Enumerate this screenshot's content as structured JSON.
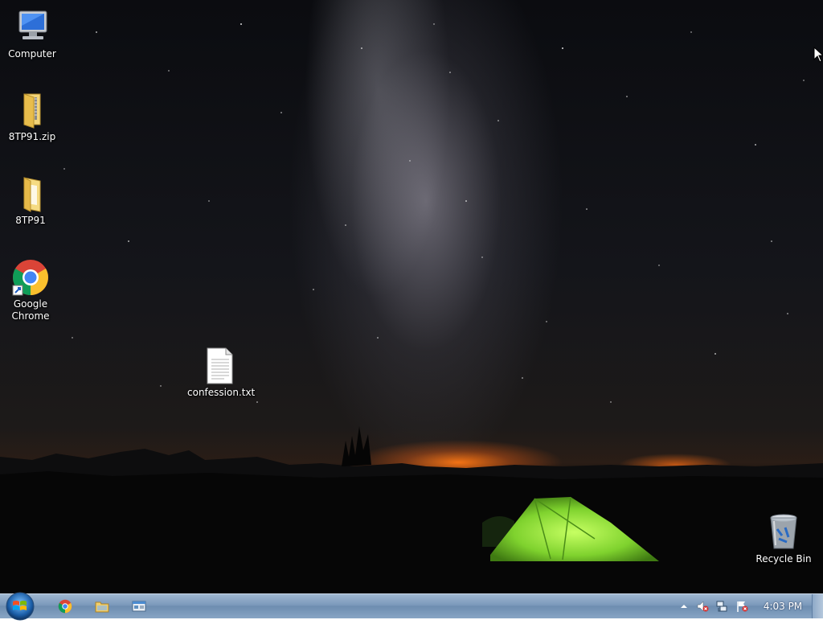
{
  "desktop": {
    "icons": [
      {
        "label": "Computer",
        "icon": "computer-icon"
      },
      {
        "label": "8TP91.zip",
        "icon": "zip-folder-icon"
      },
      {
        "label": "8TP91",
        "icon": "folder-icon"
      },
      {
        "label": "Google\nChrome",
        "icon": "chrome-icon"
      },
      {
        "label": "confession.txt",
        "icon": "text-file-icon"
      },
      {
        "label": "Recycle Bin",
        "icon": "recycle-bin-icon"
      }
    ]
  },
  "taskbar": {
    "start": {
      "icon": "windows-start-icon"
    },
    "pinned": [
      {
        "icon": "chrome-icon"
      },
      {
        "icon": "file-explorer-icon"
      },
      {
        "icon": "network-window-icon"
      }
    ],
    "tray": [
      {
        "icon": "show-hidden-icons-arrow-icon"
      },
      {
        "icon": "volume-muted-icon"
      },
      {
        "icon": "network-icon"
      },
      {
        "icon": "action-center-flag-icon"
      }
    ],
    "clock": "4:03 PM"
  },
  "colors": {
    "taskbar": "#7b99bb",
    "tent": "#8fe03a",
    "horizon_glow": "#ff7a1a"
  }
}
